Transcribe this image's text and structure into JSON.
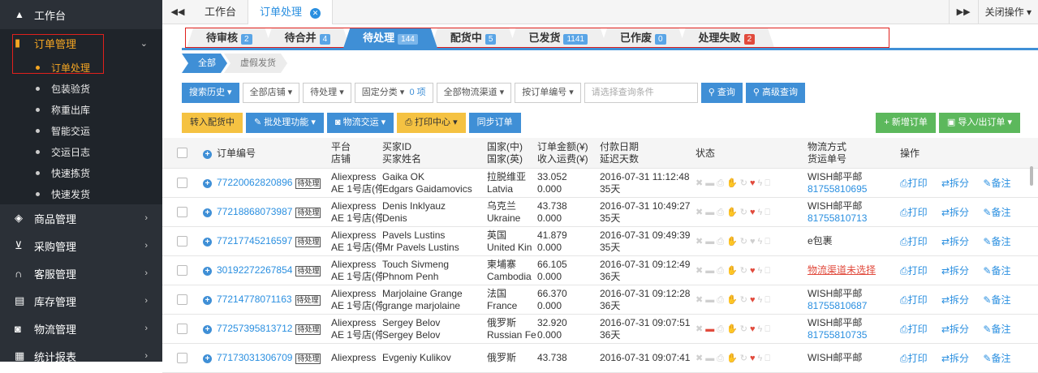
{
  "sidebar": {
    "home": "工作台",
    "order_group": "订单管理",
    "order_subs": [
      "订单处理",
      "包装验货",
      "称重出库",
      "智能交运",
      "交运日志",
      "快速拣货",
      "快速发货"
    ],
    "groups": [
      "商品管理",
      "采购管理",
      "客服管理",
      "库存管理",
      "物流管理",
      "统计报表"
    ]
  },
  "topbar": {
    "tabs": [
      "工作台",
      "订单处理"
    ],
    "close_ops": "关闭操作"
  },
  "status_tabs": [
    {
      "label": "待审核",
      "count": "2"
    },
    {
      "label": "待合并",
      "count": "4"
    },
    {
      "label": "待处理",
      "count": "144"
    },
    {
      "label": "配货中",
      "count": "5"
    },
    {
      "label": "已发货",
      "count": "1141"
    },
    {
      "label": "已作废",
      "count": "0"
    },
    {
      "label": "处理失败",
      "count": "2"
    }
  ],
  "sub_tabs": [
    "全部",
    "虚假发货"
  ],
  "filters": {
    "history": "搜索历史",
    "store": "全部店铺",
    "status": "待处理",
    "category": "固定分类",
    "count": "0 项",
    "channel": "全部物流渠道",
    "by_order": "按订单编号",
    "placeholder": "请选择查询条件",
    "search": "查询",
    "adv": "高级查询"
  },
  "actions": {
    "to_pick": "转入配货中",
    "batch": "批处理功能",
    "ship": "物流交运",
    "print": "打印中心",
    "sync": "同步订单",
    "new": "新增订单",
    "io": "导入/出订单"
  },
  "headers": {
    "order_id": "订单编号",
    "platform": "平台",
    "store": "店铺",
    "buyer_id": "买家ID",
    "buyer_name": "买家姓名",
    "country_cn": "国家(中)",
    "country_en": "国家(英)",
    "amount": "订单金额(¥)",
    "freight": "收入运费(¥)",
    "pay_date": "付款日期",
    "delay": "延迟天数",
    "status": "状态",
    "ship_method": "物流方式",
    "tracking": "货运单号",
    "ops": "操作"
  },
  "ops": {
    "print": "打印",
    "split": "拆分",
    "note": "备注"
  },
  "pending_tag": "待处理",
  "rows": [
    {
      "id": "77220062820896",
      "platform": "Aliexpress",
      "store": "AE 1号店(停)",
      "buyer_id": "Gaika OK",
      "buyer_name": "Edgars Gaidamovics",
      "cn": "拉脱维亚",
      "en": "Latvia",
      "amount": "33.052",
      "freight": "0.000",
      "date": "2016-07-31 11:12:48",
      "delay": "35天",
      "ship": "WISH邮平邮",
      "track": "81755810695"
    },
    {
      "id": "77218868073987",
      "platform": "Aliexpress",
      "store": "AE 1号店(停)",
      "buyer_id": "Denis Inklyauz",
      "buyer_name": "Denis",
      "cn": "乌克兰",
      "en": "Ukraine",
      "amount": "43.738",
      "freight": "0.000",
      "date": "2016-07-31 10:49:27",
      "delay": "35天",
      "ship": "WISH邮平邮",
      "track": "81755810713"
    },
    {
      "id": "77217745216597",
      "platform": "Aliexpress",
      "store": "AE 1号店(停)",
      "buyer_id": "Pavels Lustins",
      "buyer_name": "Mr Pavels Lustins",
      "cn": "英国",
      "en": "United Kin",
      "amount": "41.879",
      "freight": "0.000",
      "date": "2016-07-31 09:49:39",
      "delay": "35天",
      "ship": "e包裹",
      "track": ""
    },
    {
      "id": "30192272267854",
      "platform": "Aliexpress",
      "store": "AE 1号店(停)",
      "buyer_id": "Touch Sivmeng",
      "buyer_name": "Phnom Penh",
      "cn": "柬埔寨",
      "en": "Cambodia",
      "amount": "66.105",
      "freight": "0.000",
      "date": "2016-07-31 09:12:49",
      "delay": "36天",
      "ship": "物流渠道未选择",
      "track": ""
    },
    {
      "id": "77214778071163",
      "platform": "Aliexpress",
      "store": "AE 1号店(停)",
      "buyer_id": "Marjolaine Grange",
      "buyer_name": "grange marjolaine",
      "cn": "法国",
      "en": "France",
      "amount": "66.370",
      "freight": "0.000",
      "date": "2016-07-31 09:12:28",
      "delay": "36天",
      "ship": "WISH邮平邮",
      "track": "81755810687"
    },
    {
      "id": "77257395813712",
      "platform": "Aliexpress",
      "store": "AE 1号店(停)",
      "buyer_id": "Sergey Belov",
      "buyer_name": "Sergey Belov",
      "cn": "俄罗斯",
      "en": "Russian Fe",
      "amount": "32.920",
      "freight": "0.000",
      "date": "2016-07-31 09:07:51",
      "delay": "36天",
      "ship": "WISH邮平邮",
      "track": "81755810735"
    },
    {
      "id": "77173031306709",
      "platform": "Aliexpress",
      "store": "",
      "buyer_id": "Evgeniy Kulikov",
      "buyer_name": "",
      "cn": "俄罗斯",
      "en": "",
      "amount": "43.738",
      "freight": "",
      "date": "2016-07-31 09:07:41",
      "delay": "",
      "ship": "WISH邮平邮",
      "track": ""
    }
  ]
}
